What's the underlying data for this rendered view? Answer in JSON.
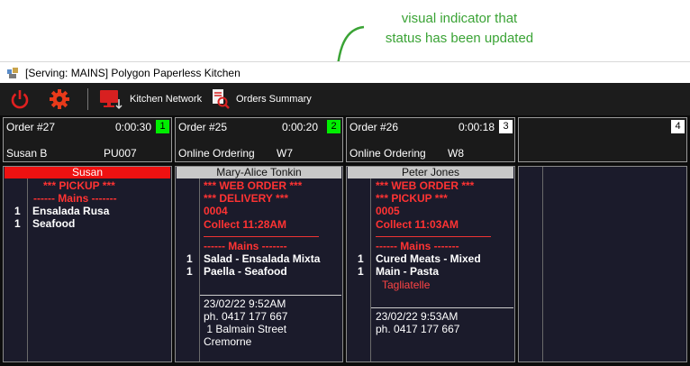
{
  "annotation": {
    "line1": "visual indicator that",
    "line2": "status has been updated"
  },
  "window": {
    "title": "[Serving: MAINS] Polygon Paperless Kitchen"
  },
  "toolbar": {
    "kitchen_network": "Kitchen Network",
    "orders_summary": "Orders Summary"
  },
  "colors": {
    "updated_indicator": "#00ee00",
    "annotation": "#3aa335",
    "alert_red": "#ff3333"
  },
  "tickets": [
    {
      "order": "Order #27",
      "time": "0:00:30",
      "slot": "1",
      "customer": "Susan B",
      "ref": "PU007",
      "name": "Susan",
      "lines": [
        "*** PICKUP ***",
        "------ Mains -------"
      ],
      "items": [
        {
          "qty": "1",
          "name": "Ensalada Rusa"
        },
        {
          "qty": "1",
          "name": "Seafood"
        }
      ]
    },
    {
      "order": "Order #25",
      "time": "0:00:20",
      "slot": "2",
      "customer": "Online Ordering",
      "ref": "W7",
      "name": "Mary-Alice Tonkin",
      "lines": [
        "*** WEB ORDER ***",
        "*** DELIVERY ***",
        "0004",
        "Collect 11:28AM",
        "------ Mains -------"
      ],
      "items": [
        {
          "qty": "1",
          "name": "Salad - Ensalada Mixta"
        },
        {
          "qty": "1",
          "name": "Paella - Seafood"
        }
      ],
      "footer": [
        "23/02/22  9:52AM",
        "ph. 0417 177 667",
        " 1 Balmain Street",
        "Cremorne"
      ]
    },
    {
      "order": "Order #26",
      "time": "0:00:18",
      "slot": "3",
      "customer": "Online Ordering",
      "ref": "W8",
      "name": "Peter Jones",
      "lines": [
        "*** WEB ORDER ***",
        "*** PICKUP ***",
        "0005",
        "Collect 11:03AM",
        "------ Mains -------"
      ],
      "items": [
        {
          "qty": "1",
          "name": "Cured Meats - Mixed"
        },
        {
          "qty": "1",
          "name": "Main - Pasta"
        }
      ],
      "modifier": "Tagliatelle",
      "footer": [
        "23/02/22  9:53AM",
        "ph. 0417 177 667"
      ]
    },
    {
      "slot": "4"
    }
  ]
}
